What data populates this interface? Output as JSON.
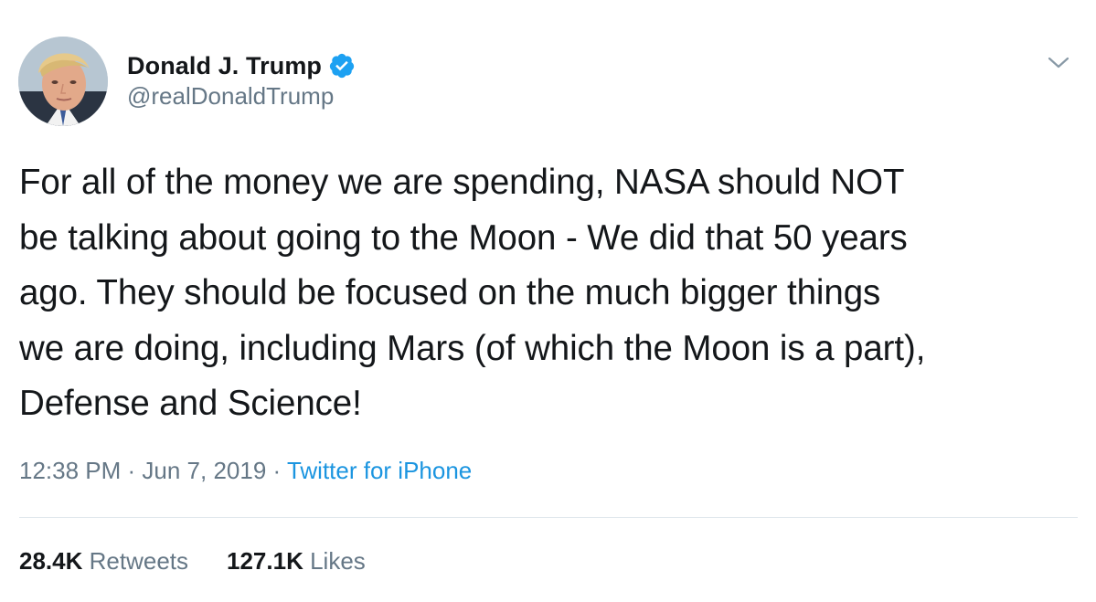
{
  "author": {
    "display_name": "Donald J. Trump",
    "handle": "@realDonaldTrump",
    "verified": true,
    "avatar_icon": "avatar-photo"
  },
  "tweet": {
    "text_lines": [
      "For all of the money we are spending, NASA should NOT",
      "be talking about going to the Moon - We did that 50 years",
      "ago. They should be focused on the much bigger things",
      "we are doing, including Mars (of which the Moon is a part),",
      "Defense and Science!"
    ]
  },
  "meta": {
    "time": "12:38 PM",
    "sep1": " · ",
    "date": "Jun 7, 2019",
    "sep2": " · ",
    "source": "Twitter for iPhone"
  },
  "stats": {
    "retweets_count": "28.4K",
    "retweets_label": "Retweets",
    "likes_count": "127.1K",
    "likes_label": "Likes"
  },
  "colors": {
    "text": "#14171a",
    "secondary": "#657786",
    "link": "#1b95e0",
    "verified": "#1da1f2",
    "divider": "#e1e8ed"
  },
  "icons": {
    "verified": "verified-badge-icon",
    "menu": "chevron-down-icon"
  }
}
